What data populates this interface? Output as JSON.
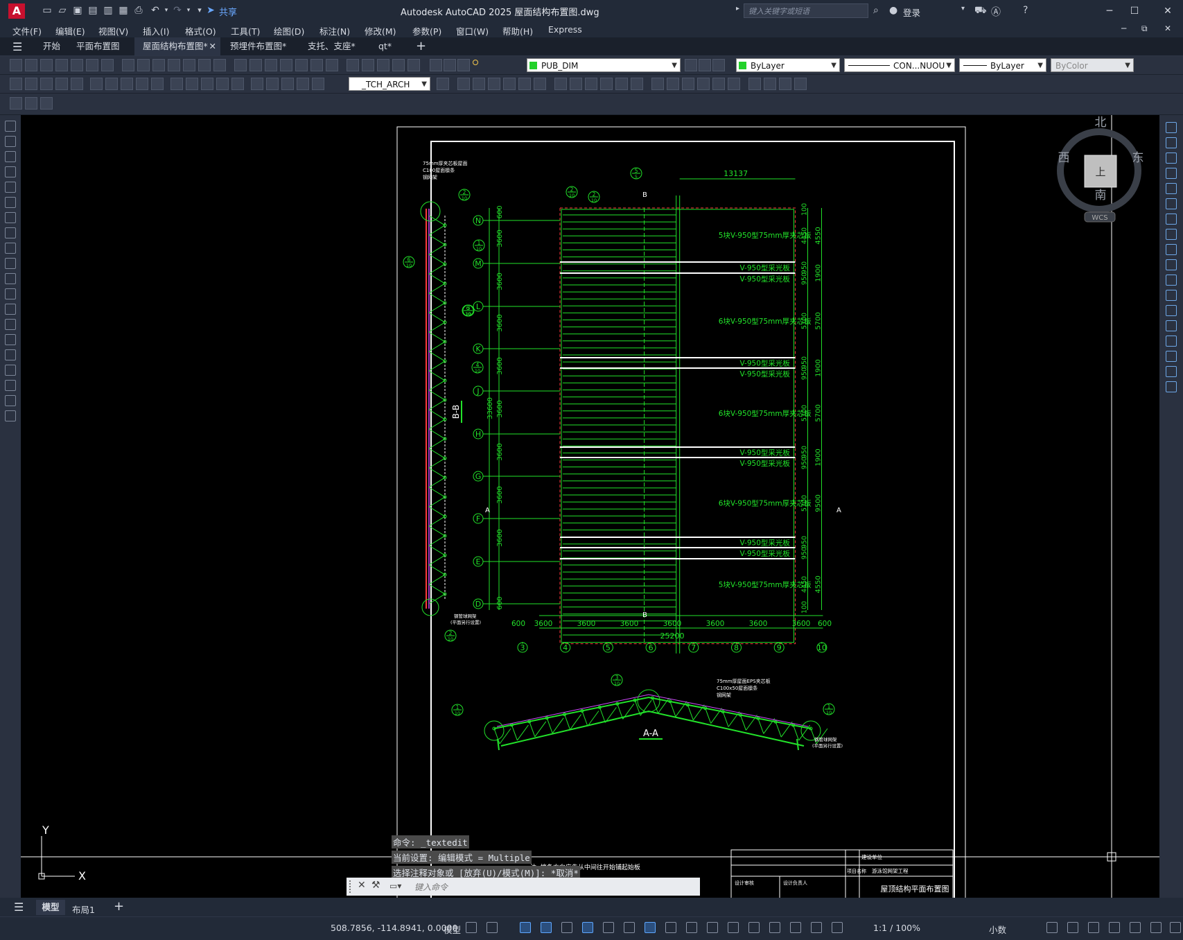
{
  "window": {
    "app_logo": "A",
    "share": "共享",
    "title": "Autodesk AutoCAD 2025    屋面结构布置图.dwg",
    "search_placeholder": "键入关键字或短语",
    "login": "登录"
  },
  "menu": [
    "文件(F)",
    "编辑(E)",
    "视图(V)",
    "插入(I)",
    "格式(O)",
    "工具(T)",
    "绘图(D)",
    "标注(N)",
    "修改(M)",
    "参数(P)",
    "窗口(W)",
    "帮助(H)",
    "Express"
  ],
  "tabs": [
    {
      "label": "开始"
    },
    {
      "label": "平面布置图"
    },
    {
      "label": "屋面结构布置图*",
      "active": true
    },
    {
      "label": "预埋件布置图*"
    },
    {
      "label": "支托、支座*"
    },
    {
      "label": "qt*"
    }
  ],
  "toolbar": {
    "layer": "PUB_DIM",
    "color": "ByLayer",
    "linetype": "CON...NUOU",
    "lineweight": "ByLayer",
    "plotstyle": "ByColor",
    "textstyle": "_TCH_ARCH"
  },
  "viewcube": {
    "north": "北",
    "south": "南",
    "east": "东",
    "west": "西",
    "top": "上",
    "wcs": "WCS"
  },
  "ucs": {
    "x": "X",
    "y": "Y"
  },
  "drawing": {
    "top_dim": "13137",
    "rows": [
      "N",
      "M",
      "L",
      "K",
      "J",
      "H",
      "G",
      "F",
      "E",
      "D"
    ],
    "cols": [
      "3",
      "4",
      "5",
      "6",
      "7",
      "8",
      "9",
      "10"
    ],
    "bottom_dims": [
      "600",
      "3600",
      "3600",
      "3600",
      "3600",
      "3600",
      "3600",
      "3600",
      "600"
    ],
    "bottom_total": "25200",
    "left_total": "33600",
    "left_dims": [
      "600",
      "3600",
      "3600",
      "3600",
      "3600",
      "3600",
      "3600",
      "3600",
      "3600",
      "600"
    ],
    "right_dims1": [
      "100",
      "4450",
      "950",
      "950",
      "5700",
      "950",
      "950",
      "5700",
      "950",
      "950",
      "5700",
      "950",
      "950",
      "4450",
      "100"
    ],
    "right_dims2": [
      "4550",
      "1900",
      "5700",
      "1900",
      "5700",
      "1900",
      "9500",
      "4550"
    ],
    "panel_labels": [
      "5块V-950型75mm厚夹芯板",
      "V-950型采光板",
      "V-950型采光板",
      "6块V-950型75mm厚夹芯板",
      "V-950型采光板",
      "V-950型采光板",
      "6块V-950型75mm厚夹芯板",
      "V-950型采光板",
      "V-950型采光板",
      "6块V-950型75mm厚夹芯板",
      "V-950型采光板",
      "V-950型采光板",
      "5块V-950型75mm厚夹芯板"
    ],
    "section_bb": "B-B",
    "section_aa": "A-A",
    "mark_b": "B",
    "mark_a": "A",
    "detail_nums": [
      "2",
      "10",
      "1",
      "10",
      "6",
      "10",
      "3",
      "10",
      "4",
      "10",
      "5"
    ],
    "legend_top": [
      "75mm厚夹芯板屋面",
      "C100屋面檩条",
      "钢网架"
    ],
    "legend_aa": [
      "75mm厚屋面EPS夹芯板",
      "C100x50屋面檩条",
      "钢网架"
    ],
    "support_note": "钢管球网架",
    "support_note2": "(平面另行设置)",
    "note": "注: 檩条方向应先从中间往开始铺起始板",
    "titleblock": {
      "unit_label": "建设单位",
      "project_label": "项目名称",
      "project": "游泳馆网架工程",
      "designer": "设计审核",
      "checker": "设计负责人",
      "drawing_title": "屋顶结构平面布置图"
    }
  },
  "command": {
    "history": [
      "命令:  _textedit",
      "当前设置: 编辑模式 = Multiple",
      "选择注释对象或 [放弃(U)/模式(M)]: *取消*"
    ],
    "placeholder": "键入命令"
  },
  "layouts": [
    "模型",
    "布局1"
  ],
  "status": {
    "coords": "508.7856, -114.8941, 0.0000",
    "model": "模型",
    "scale": "1:1 / 100%",
    "units": "小数"
  }
}
